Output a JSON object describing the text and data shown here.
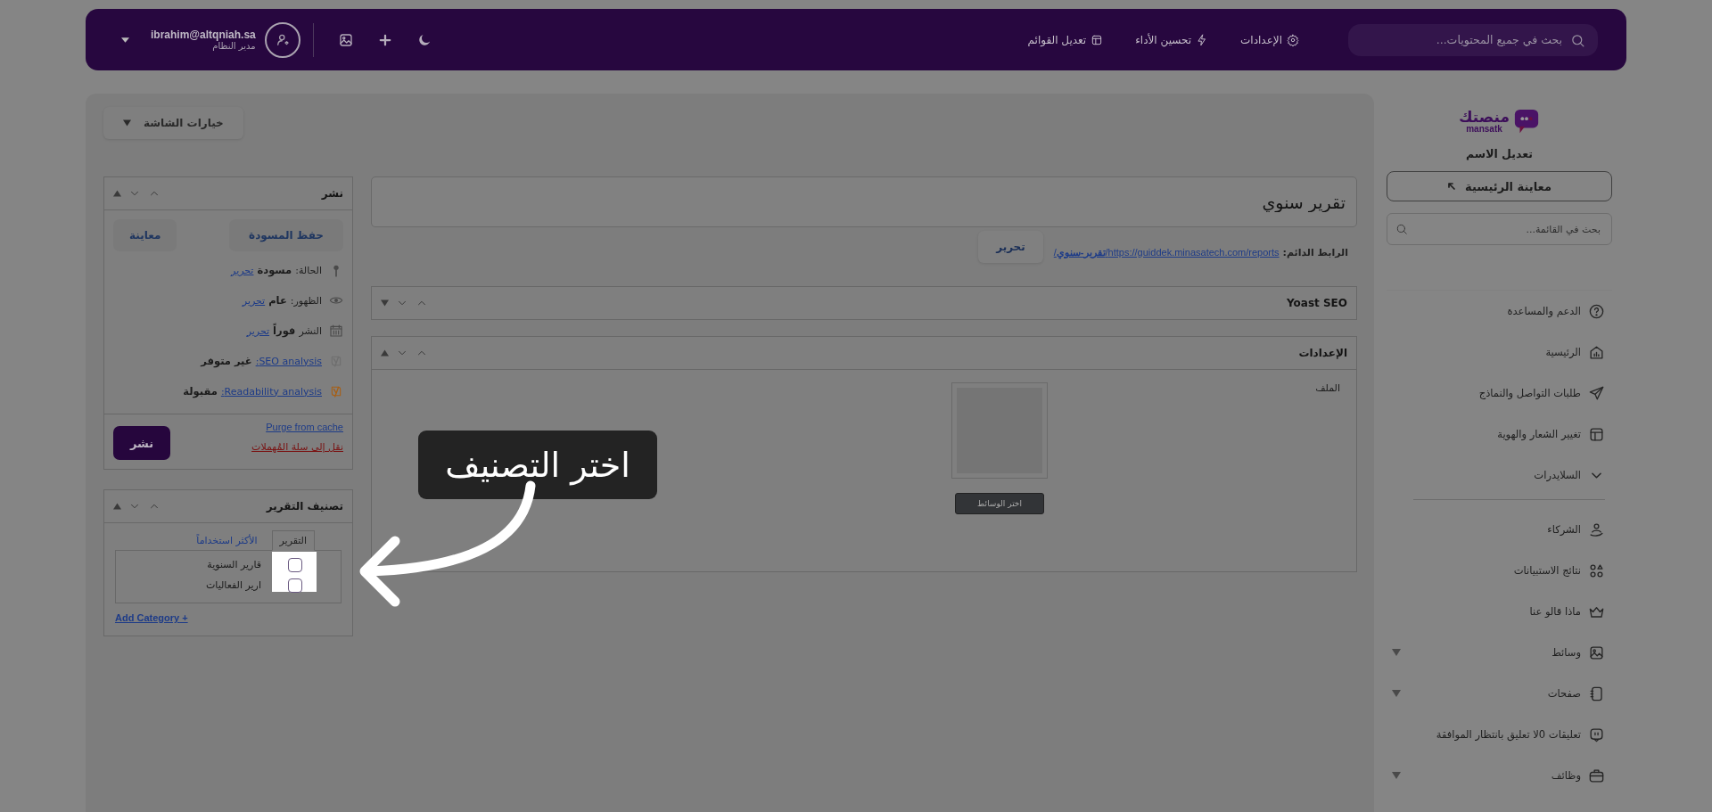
{
  "topbar": {
    "search": {
      "placeholder": "بحث في جميع المحتويات..."
    },
    "nav": [
      {
        "label": "الإعدادات"
      },
      {
        "label": "تحسين الأداء"
      },
      {
        "label": "تعديل القوائم"
      }
    ],
    "user": {
      "email": "ibrahim@altqniah.sa",
      "role": "مدير النظام"
    }
  },
  "sidebar": {
    "logo": {
      "name": "منصتك",
      "latin": "mansatk"
    },
    "site_name": "تعديل الاسم",
    "preview_button": "معاينة الرئيسية",
    "search": {
      "placeholder": "بحث في القائمة..."
    },
    "sections": [
      [
        {
          "label": "الدعم والمساعدة",
          "kind": "link",
          "has_submenu": false
        },
        {
          "label": "الرئيسية",
          "kind": "link",
          "has_submenu": false
        },
        {
          "label": "طلبات التواصل والنماذج",
          "kind": "link",
          "has_submenu": false
        },
        {
          "label": "تغيير الشعار والهوية",
          "kind": "link",
          "has_submenu": false
        },
        {
          "label": "السلايدرات",
          "kind": "group",
          "has_submenu": false
        }
      ],
      [
        {
          "label": "الشركاء",
          "kind": "link",
          "has_submenu": false
        },
        {
          "label": "نتائج الاستبيانات",
          "kind": "link",
          "has_submenu": false
        },
        {
          "label": "ماذا قالو عنا",
          "kind": "link",
          "has_submenu": false
        },
        {
          "label": "وسائط",
          "kind": "link",
          "has_submenu": true
        },
        {
          "label": "صفحات",
          "kind": "link",
          "has_submenu": true
        },
        {
          "label": "تعليقات 0لا تعليق بانتظار الموافقة",
          "kind": "link",
          "has_submenu": false
        },
        {
          "label": "وظائف",
          "kind": "link",
          "has_submenu": true
        }
      ]
    ]
  },
  "screen_options": "خيارات الشاشة",
  "editor": {
    "title": "تقرير سنوي",
    "permalink": {
      "label": "الرابط الدائم:",
      "url": "https://guiddek.minasatech.com/reports/**تقرير-سنوي**/",
      "edit_button": "تحرير"
    },
    "boxes": [
      {
        "title": "Yoast SEO",
        "expanded": false
      },
      {
        "title": "الإعدادات",
        "expanded": true,
        "field_label": "الملف",
        "media_button": "اختر الوسائط"
      }
    ]
  },
  "publish": {
    "title": "نشر",
    "save_draft": "حفظ المسودة",
    "preview": "معاينة",
    "rows": [
      {
        "kind": "status",
        "label": "الحالة:",
        "value": "مسودة",
        "link": "تحرير"
      },
      {
        "kind": "visibility",
        "label": "الظهور:",
        "value": "عام",
        "link": "تحرير"
      },
      {
        "kind": "schedule",
        "label": "النشر",
        "value": "فوراً",
        "link": "تحرير"
      },
      {
        "kind": "analysis",
        "link": "SEO analysis:",
        "value": "غير متوفر",
        "color": "#6f6f6f"
      },
      {
        "kind": "analysis",
        "link": "Readability analysis:",
        "value": "مقبولة",
        "color": "#a85f14"
      }
    ],
    "purge_link": "Purge from cache",
    "trash_link": "نقل إلى سلة المُهملات",
    "publish_button": "نشر"
  },
  "categories": {
    "title": "تصنيف التقرير",
    "tabs": [
      {
        "label": "التقرير",
        "selected": true
      },
      {
        "label": "الأكثر استخداماً",
        "selected": false
      }
    ],
    "items": [
      {
        "label": "قارير السنوية",
        "checked": false
      },
      {
        "label": "ارير الفعاليات",
        "checked": false
      }
    ],
    "add_link": "+ Add Category"
  },
  "tour": {
    "tip": "اختر التصنيف"
  }
}
